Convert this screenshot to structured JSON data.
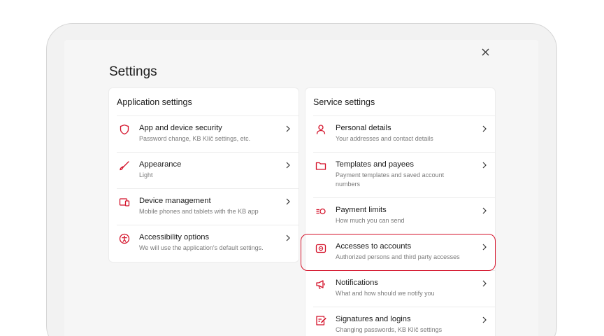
{
  "page": {
    "title": "Settings",
    "accent_color": "#d4122a"
  },
  "application_settings": {
    "title": "Application settings",
    "items": [
      {
        "label": "App and device security",
        "sub": "Password change, KB Klíč settings, etc.",
        "icon": "shield-icon"
      },
      {
        "label": "Appearance",
        "sub": "Light",
        "icon": "brush-icon"
      },
      {
        "label": "Device management",
        "sub": "Mobile phones and tablets with the KB app",
        "icon": "devices-icon"
      },
      {
        "label": "Accessibility options",
        "sub": "We will use the application's default settings.",
        "icon": "accessibility-icon"
      }
    ]
  },
  "service_settings": {
    "title": "Service settings",
    "items": [
      {
        "label": "Personal details",
        "sub": "Your addresses and contact details",
        "icon": "person-icon"
      },
      {
        "label": "Templates and payees",
        "sub": "Payment templates and saved account numbers",
        "icon": "folder-icon"
      },
      {
        "label": "Payment limits",
        "sub": "How much you can send",
        "icon": "limits-icon"
      },
      {
        "label": "Accesses to accounts",
        "sub": "Authorized persons and third party accesses",
        "icon": "safe-icon",
        "highlighted": true
      },
      {
        "label": "Notifications",
        "sub": "What and how should we notify you",
        "icon": "megaphone-icon"
      },
      {
        "label": "Signatures and logins",
        "sub": "Changing passwords, KB Klíč settings",
        "icon": "signature-icon"
      }
    ]
  }
}
